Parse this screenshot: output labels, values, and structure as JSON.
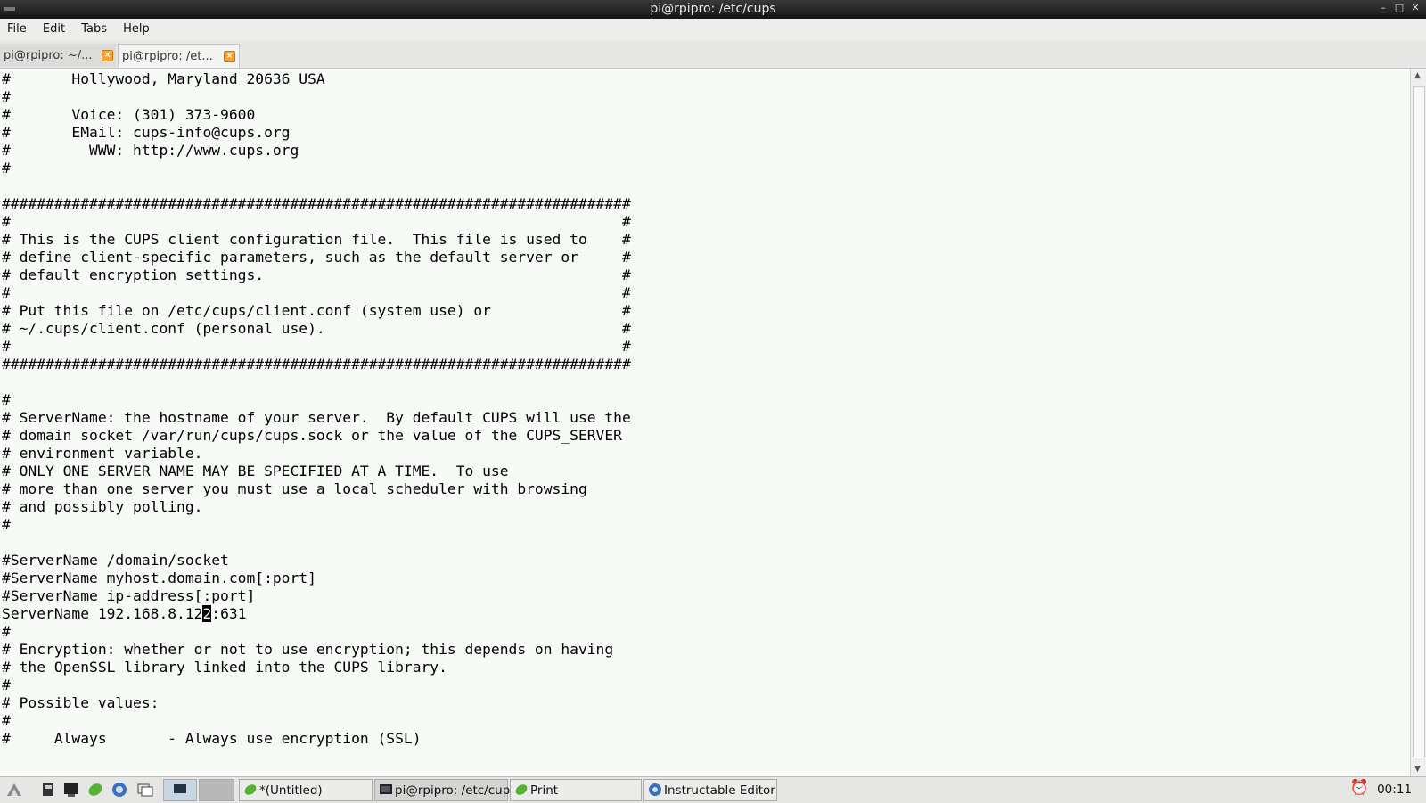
{
  "window": {
    "title": "pi@rpipro: /etc/cups"
  },
  "menu": [
    "File",
    "Edit",
    "Tabs",
    "Help"
  ],
  "tabs": [
    {
      "label": "pi@rpipro: ~/..."
    },
    {
      "label": "pi@rpipro: /et..."
    }
  ],
  "terminal": {
    "lines": [
      "#       Hollywood, Maryland 20636 USA",
      "#",
      "#       Voice: (301) 373-9600",
      "#       EMail: cups-info@cups.org",
      "#         WWW: http://www.cups.org",
      "#",
      "",
      "########################################################################",
      "#                                                                      #",
      "# This is the CUPS client configuration file.  This file is used to    #",
      "# define client-specific parameters, such as the default server or     #",
      "# default encryption settings.                                         #",
      "#                                                                      #",
      "# Put this file on /etc/cups/client.conf (system use) or               #",
      "# ~/.cups/client.conf (personal use).                                  #",
      "#                                                                      #",
      "########################################################################",
      "",
      "#",
      "# ServerName: the hostname of your server.  By default CUPS will use the",
      "# domain socket /var/run/cups/cups.sock or the value of the CUPS_SERVER",
      "# environment variable.",
      "# ONLY ONE SERVER NAME MAY BE SPECIFIED AT A TIME.  To use",
      "# more than one server you must use a local scheduler with browsing",
      "# and possibly polling.",
      "#",
      "",
      "#ServerName /domain/socket",
      "#ServerName myhost.domain.com[:port]",
      "#ServerName ip-address[:port]",
      "ServerName 192.168.8.122:631",
      "#",
      "# Encryption: whether or not to use encryption; this depends on having",
      "# the OpenSSL library linked into the CUPS library.",
      "#",
      "# Possible values:",
      "#",
      "#     Always       - Always use encryption (SSL)"
    ],
    "cursor": {
      "line": 30,
      "col": 23
    }
  },
  "taskbar": {
    "buttons": [
      {
        "label": "*(Untitled)",
        "icon": "leafpad-icon"
      },
      {
        "label": "pi@rpipro: /etc/cups",
        "icon": "terminal-icon"
      },
      {
        "label": "Print",
        "icon": "leafpad-icon"
      },
      {
        "label": "Instructable Editor",
        "icon": "browser-icon"
      }
    ],
    "clock": "00:11"
  }
}
